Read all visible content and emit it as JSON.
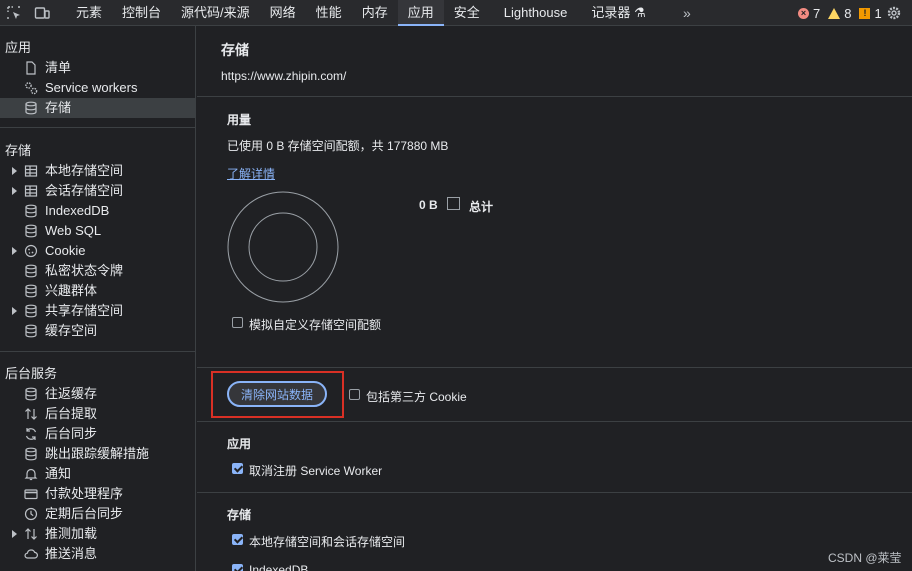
{
  "toolbar": {
    "tabs": [
      "元素",
      "控制台",
      "源代码/来源",
      "网络",
      "性能",
      "内存",
      "应用",
      "安全",
      "Lighthouse",
      "记录器"
    ],
    "active_tab": "应用",
    "more": "»",
    "errors": "7",
    "warnings": "8",
    "issues": "1"
  },
  "sidebar": {
    "app_title": "应用",
    "app_items": [
      "清单",
      "Service workers",
      "存储"
    ],
    "storage_title": "存储",
    "storage_items": [
      "本地存储空间",
      "会话存储空间",
      "IndexedDB",
      "Web SQL",
      "Cookie",
      "私密状态令牌",
      "兴趣群体",
      "共享存储空间",
      "缓存空间"
    ],
    "bg_title": "后台服务",
    "bg_items": [
      "往返缓存",
      "后台提取",
      "后台同步",
      "跳出跟踪缓解措施",
      "通知",
      "付款处理程序",
      "定期后台同步",
      "推测加载",
      "推送消息"
    ]
  },
  "main": {
    "title": "存储",
    "origin": "https://www.zhipin.com/",
    "usage_title": "用量",
    "usage_text": "已使用 0 B 存储空间配额，共 177880 MB",
    "learn_more": "了解详情",
    "legend_value": "0 B",
    "legend_label": "总计",
    "simulate_quota": "模拟自定义存储空间配额",
    "clear_button": "清除网站数据",
    "third_party_cookie": "包括第三方 Cookie",
    "app_section": "应用",
    "unregister_sw": "取消注册 Service Worker",
    "storage_section": "存储",
    "local_session": "本地存储空间和会话存储空间",
    "indexeddb": "IndexedDB"
  },
  "watermark": "CSDN @莱莹"
}
